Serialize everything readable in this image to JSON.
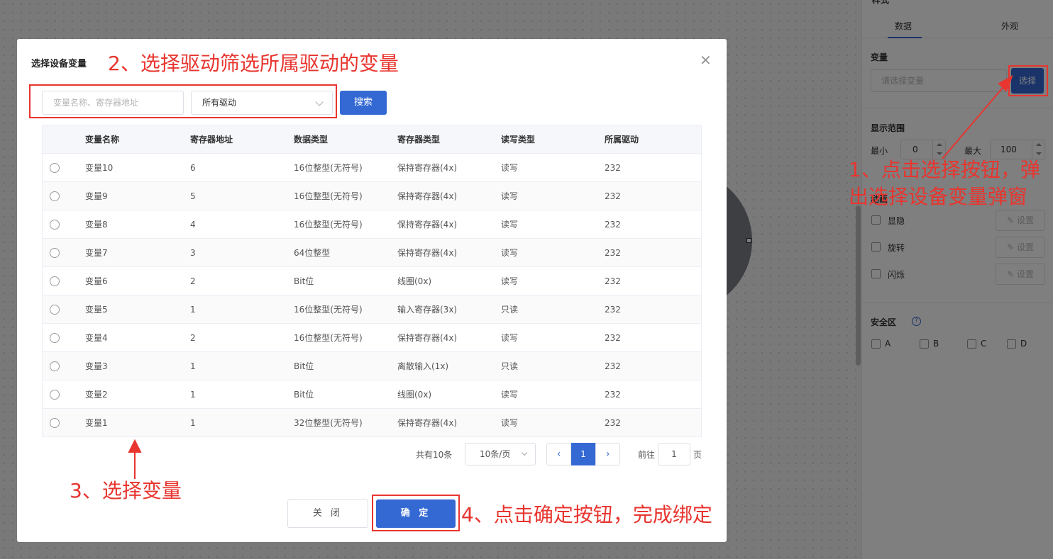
{
  "panel": {
    "top_title": "样式",
    "tabs": [
      "数据",
      "外观"
    ],
    "variable_label": "变量",
    "variable_placeholder": "请选择变量",
    "select_button": "选择",
    "range_label": "显示范围",
    "min_label": "最小",
    "min_value": "0",
    "max_label": "最大",
    "max_value": "100",
    "anim_label": "动画",
    "anim_items": [
      {
        "label": "显隐",
        "set": "设置"
      },
      {
        "label": "旋转",
        "set": "设置"
      },
      {
        "label": "闪烁",
        "set": "设置"
      }
    ],
    "safe_zone_label": "安全区",
    "safe_zones": [
      "A",
      "B",
      "C",
      "D"
    ]
  },
  "dialog": {
    "title": "选择设备变量",
    "search_placeholder": "变量名称、寄存器地址",
    "driver_select_value": "所有驱动",
    "search_button": "搜索",
    "columns": [
      "变量名称",
      "寄存器地址",
      "数据类型",
      "寄存器类型",
      "读写类型",
      "所属驱动"
    ],
    "rows": [
      [
        "变量10",
        "6",
        "16位整型(无符号)",
        "保持寄存器(4x)",
        "读写",
        "232"
      ],
      [
        "变量9",
        "5",
        "16位整型(无符号)",
        "保持寄存器(4x)",
        "读写",
        "232"
      ],
      [
        "变量8",
        "4",
        "16位整型(无符号)",
        "保持寄存器(4x)",
        "读写",
        "232"
      ],
      [
        "变量7",
        "3",
        "64位整型",
        "保持寄存器(4x)",
        "读写",
        "232"
      ],
      [
        "变量6",
        "2",
        "Bit位",
        "线圈(0x)",
        "读写",
        "232"
      ],
      [
        "变量5",
        "1",
        "16位整型(无符号)",
        "输入寄存器(3x)",
        "只读",
        "232"
      ],
      [
        "变量4",
        "2",
        "16位整型(无符号)",
        "保持寄存器(4x)",
        "读写",
        "232"
      ],
      [
        "变量3",
        "1",
        "Bit位",
        "离散输入(1x)",
        "只读",
        "232"
      ],
      [
        "变量2",
        "1",
        "Bit位",
        "线圈(0x)",
        "读写",
        "232"
      ],
      [
        "变量1",
        "1",
        "32位整型(无符号)",
        "保持寄存器(4x)",
        "读写",
        "232"
      ]
    ],
    "pagination": {
      "total": "共有10条",
      "page_size": "10条/页",
      "current_page": "1",
      "goto_label": "前往",
      "goto_value": "1",
      "page_suffix": "页"
    },
    "close_button": "关 闭",
    "ok_button": "确 定"
  },
  "annotations": {
    "step1_line1": "1、点击选择按钮，弹",
    "step1_line2": "出选择设备变量弹窗",
    "step2": "2、选择驱动筛选所属驱动的变量",
    "step3": "3、选择变量",
    "step4": "4、点击确定按钮，完成绑定"
  },
  "colors": {
    "primary": "#3469d4",
    "annotation": "#e8352f"
  }
}
